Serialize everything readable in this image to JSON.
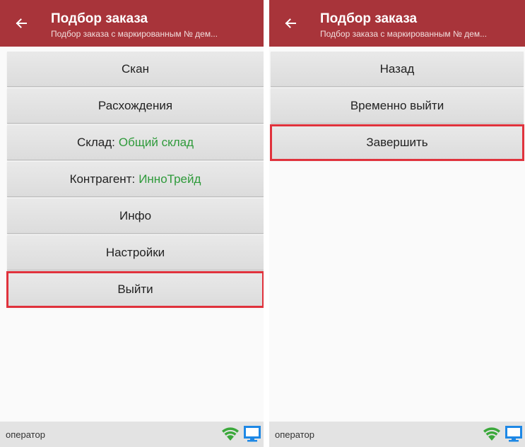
{
  "colors": {
    "app_bar": "#a8343a",
    "highlight": "#e0323c",
    "value_green": "#2e9a3a",
    "wifi_green": "#3aa83a",
    "monitor_blue": "#1e88e5"
  },
  "left": {
    "header": {
      "back_icon": "arrow-left-icon",
      "title": "Подбор заказа",
      "subtitle": "Подбор заказа с маркированным № дем..."
    },
    "menu": [
      {
        "label": "Скан"
      },
      {
        "label": "Расхождения"
      },
      {
        "label": "Склад:",
        "value": "Общий склад"
      },
      {
        "label": "Контрагент:",
        "value": "ИнноТрейд"
      },
      {
        "label": "Инфо"
      },
      {
        "label": "Настройки"
      },
      {
        "label": "Выйти",
        "highlighted": true
      }
    ],
    "status": {
      "user": "оператор",
      "icons": [
        "wifi-icon",
        "monitor-icon"
      ]
    }
  },
  "right": {
    "header": {
      "back_icon": "arrow-left-icon",
      "title": "Подбор заказа",
      "subtitle": "Подбор заказа с маркированным № дем..."
    },
    "menu": [
      {
        "label": "Назад"
      },
      {
        "label": "Временно выйти"
      },
      {
        "label": "Завершить",
        "highlighted": true
      }
    ],
    "status": {
      "user": "оператор",
      "icons": [
        "wifi-icon",
        "monitor-icon"
      ]
    }
  }
}
